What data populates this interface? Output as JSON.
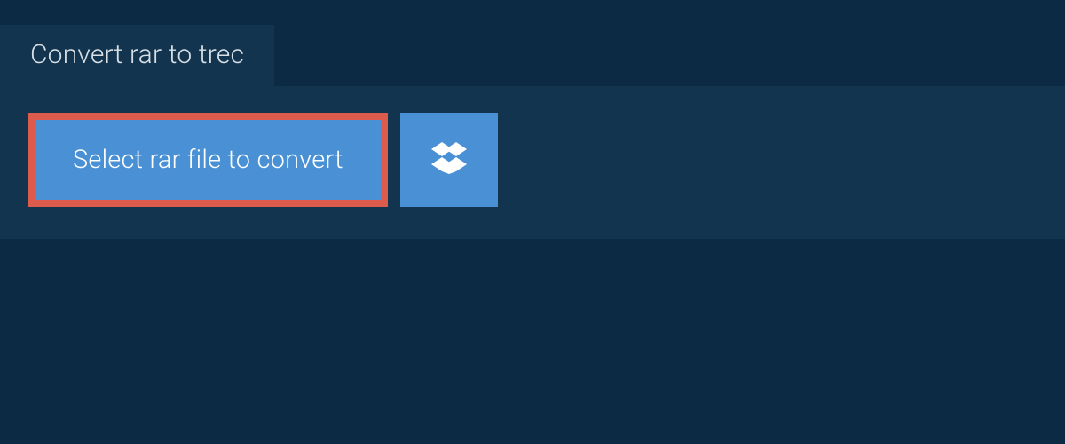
{
  "tab": {
    "label": "Convert rar to trec"
  },
  "actions": {
    "select_file_label": "Select rar file to convert"
  }
}
